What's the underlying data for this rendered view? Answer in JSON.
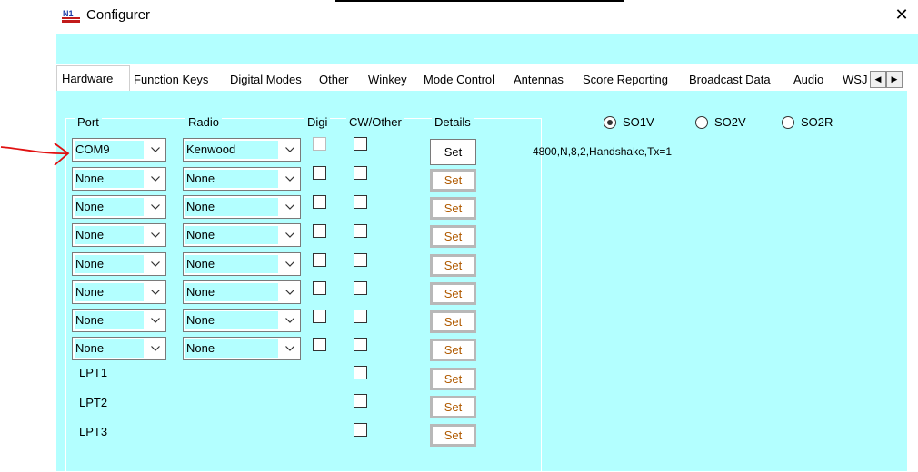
{
  "window": {
    "title": "Configurer",
    "icon": "nm-app-icon",
    "close_icon": "close-icon"
  },
  "tabs": [
    "Hardware",
    "Function Keys",
    "Digital Modes",
    "Other",
    "Winkey",
    "Mode Control",
    "Antennas",
    "Score Reporting",
    "Broadcast Data",
    "Audio",
    "WSJ"
  ],
  "active_tab": "Hardware",
  "tab_scroll": {
    "left_icon": "scroll-left-icon",
    "right_icon": "scroll-right-icon"
  },
  "headers": {
    "port": "Port",
    "radio": "Radio",
    "digi": "Digi",
    "cw": "CW/Other",
    "details": "Details"
  },
  "rows": [
    {
      "port": "COM9",
      "radio": "Kenwood"
    },
    {
      "port": "None",
      "radio": "None"
    },
    {
      "port": "None",
      "radio": "None"
    },
    {
      "port": "None",
      "radio": "None"
    },
    {
      "port": "None",
      "radio": "None"
    },
    {
      "port": "None",
      "radio": "None"
    },
    {
      "port": "None",
      "radio": "None"
    },
    {
      "port": "None",
      "radio": "None"
    }
  ],
  "lpt_rows": [
    "LPT1",
    "LPT2",
    "LPT3"
  ],
  "set_label": "Set",
  "details_text": "4800,N,8,2,Handshake,Tx=1",
  "radios": {
    "so1v": "SO1V",
    "so2v": "SO2V",
    "so2r": "SO2R",
    "selected": "SO1V"
  },
  "colors": {
    "panel_bg": "#b3ffff",
    "annotation": "#e01010"
  }
}
